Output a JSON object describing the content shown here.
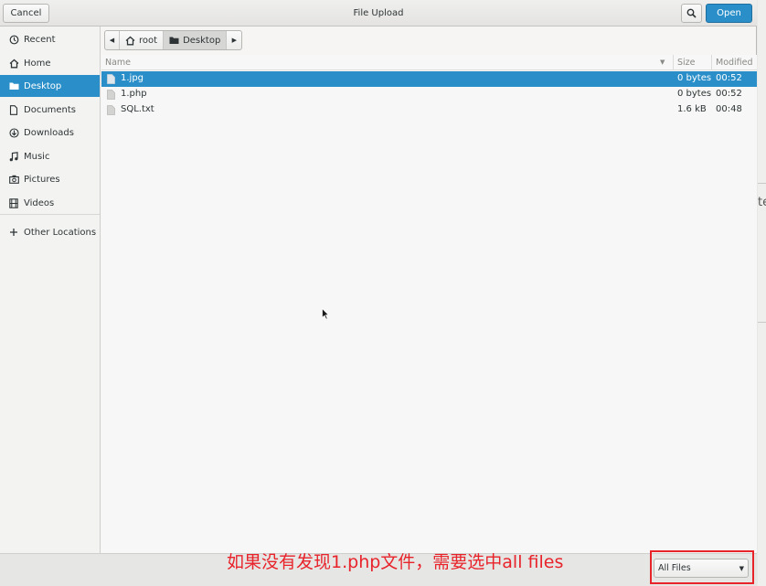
{
  "header": {
    "cancel_label": "Cancel",
    "title": "File Upload",
    "search_icon": "search-icon",
    "open_label": "Open"
  },
  "sidebar": {
    "items": [
      {
        "label": "Recent",
        "icon": "clock-icon"
      },
      {
        "label": "Home",
        "icon": "home-icon"
      },
      {
        "label": "Desktop",
        "icon": "folder-icon",
        "active": true
      },
      {
        "label": "Documents",
        "icon": "document-icon"
      },
      {
        "label": "Downloads",
        "icon": "download-icon"
      },
      {
        "label": "Music",
        "icon": "music-icon"
      },
      {
        "label": "Pictures",
        "icon": "camera-icon"
      },
      {
        "label": "Videos",
        "icon": "film-icon"
      }
    ],
    "other_locations": {
      "label": "Other Locations",
      "icon": "plus-icon"
    }
  },
  "pathbar": {
    "segments": [
      {
        "label": "root",
        "icon": "home-icon"
      },
      {
        "label": "Desktop",
        "icon": "folder-icon",
        "current": true
      }
    ]
  },
  "filelist": {
    "columns": {
      "name": "Name",
      "size": "Size",
      "modified": "Modified"
    },
    "rows": [
      {
        "name": "1.jpg",
        "size": "0 bytes",
        "modified": "00:52",
        "selected": true
      },
      {
        "name": "1.php",
        "size": "0 bytes",
        "modified": "00:52"
      },
      {
        "name": "SQL.txt",
        "size": "1.6 kB",
        "modified": "00:48"
      }
    ]
  },
  "bottom": {
    "annotation": "如果没有发现1.php文件，需要选中all files",
    "filter_value": "All Files"
  },
  "background_window": {
    "partial_text": "te"
  },
  "colors": {
    "accent": "#2a8fc9",
    "annotation": "#e8232a"
  }
}
